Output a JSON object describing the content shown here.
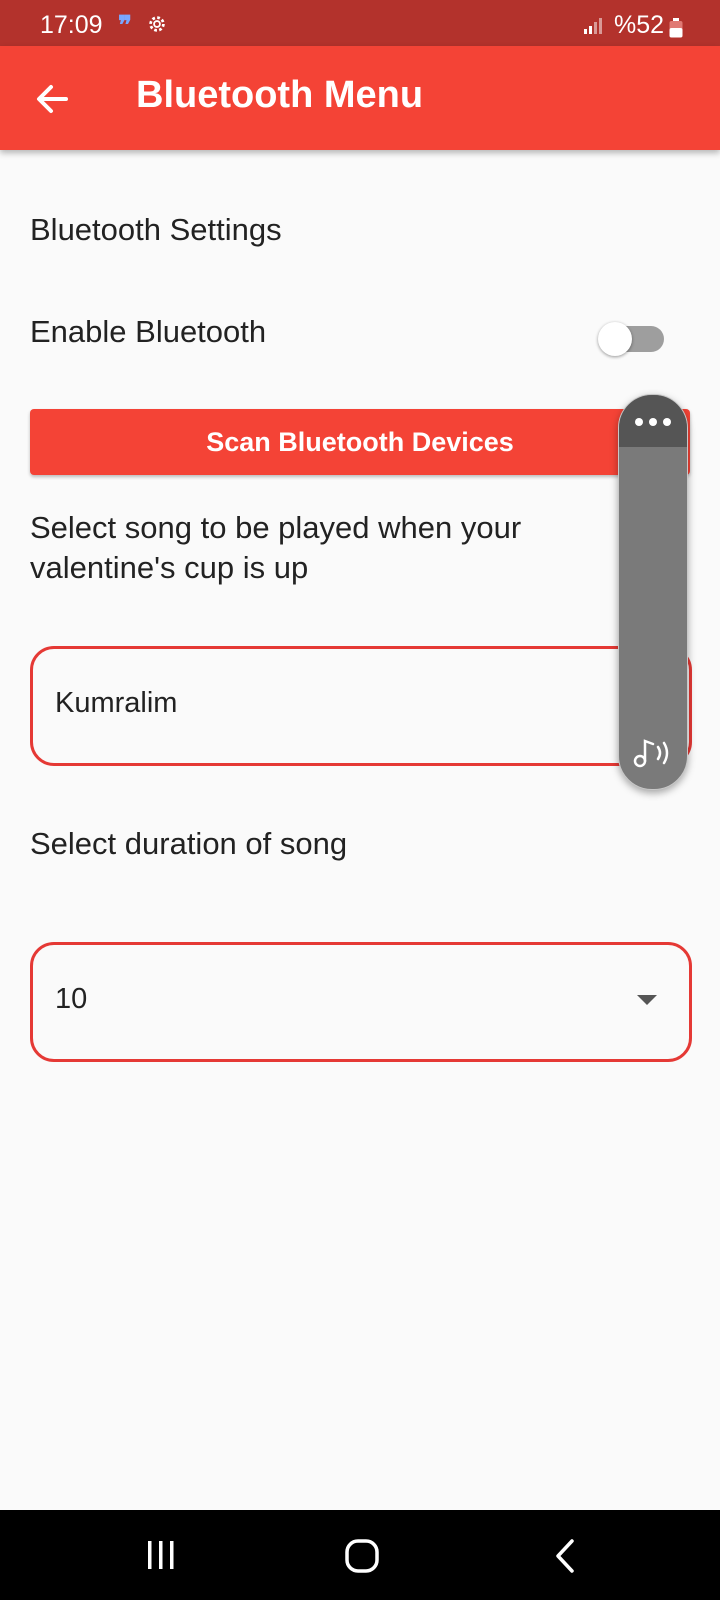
{
  "status_bar": {
    "time": "17:09",
    "notification_icons": [
      "quote-icon",
      "gear-icon"
    ],
    "battery_text": "%52",
    "color": "#b3322c"
  },
  "app_bar": {
    "title": "Bluetooth Menu",
    "back_icon": "arrow-left-icon",
    "color": "#f44336"
  },
  "settings": {
    "section_title": "Bluetooth Settings",
    "enable_label": "Enable Bluetooth",
    "enable_on": false,
    "scan_button_label": "Scan Bluetooth Devices",
    "song_prompt": "Select song to be played when your valentine's cup is up",
    "song_value": "Kumralim",
    "duration_label": "Select duration of song",
    "duration_value": "10"
  },
  "floating_panel": {
    "icons": [
      "more-horizontal-icon",
      "music-note-sound-icon"
    ]
  },
  "nav_bar": {
    "icons": [
      "recents-icon",
      "home-icon",
      "back-icon"
    ]
  },
  "colors": {
    "accent": "#f44336",
    "field_border": "#e53935"
  }
}
